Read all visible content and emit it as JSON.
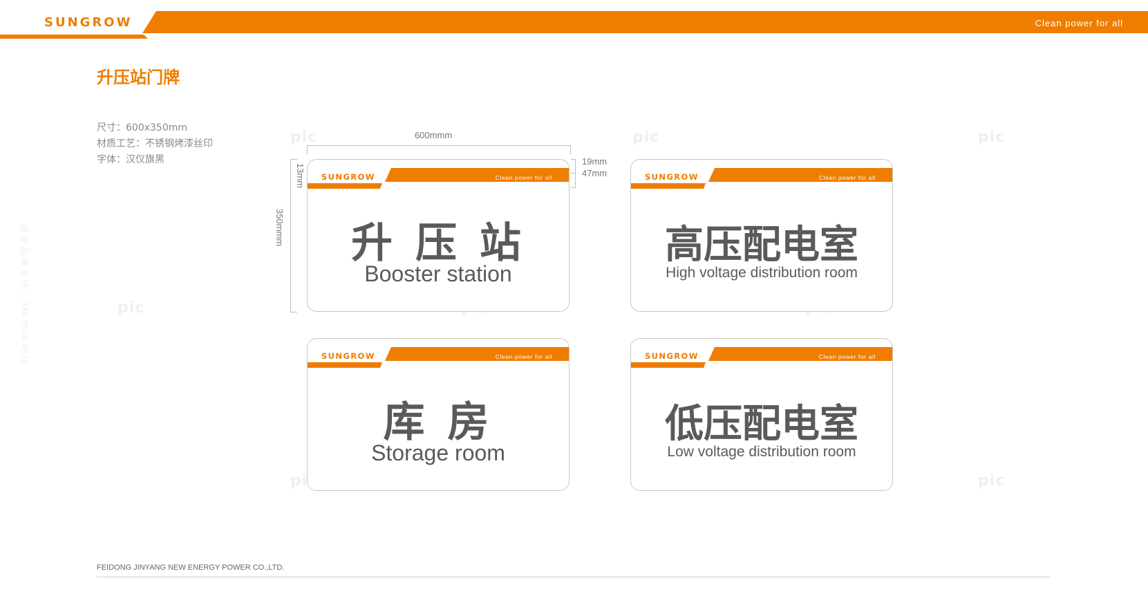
{
  "colors": {
    "accent": "#ef7d00",
    "text": "#5a5a5a",
    "border": "#c9c9c9"
  },
  "header": {
    "logo": "SUNGROW",
    "slogan": "Clean  power  for  all"
  },
  "page_title": "升压站门牌",
  "specs": [
    "尺寸：600x350mm",
    "材质工艺：不锈钢烤漆丝印",
    "字体：汉仪旗黑"
  ],
  "dimensions": {
    "width": "600mmm",
    "height": "350mmm",
    "side": "13mm",
    "top_band": "19mm",
    "band_height": "47mm"
  },
  "signs": [
    {
      "logo": "SUNGROW",
      "slogan": "Clean  power  for  all",
      "cn": "升 压 站",
      "en": "Booster station"
    },
    {
      "logo": "SUNGROW",
      "slogan": "Clean  power  for  all",
      "cn": "高压配电室",
      "en": "High voltage distribution room"
    },
    {
      "logo": "SUNGROW",
      "slogan": "Clean  power  for  all",
      "cn": "库 房",
      "en": "Storage room"
    },
    {
      "logo": "SUNGROW",
      "slogan": "Clean  power  for  all",
      "cn": "低压配电室",
      "en": "Low voltage distribution room"
    }
  ],
  "watermark": {
    "text": "pic",
    "side_text": "德 嘉 品 牌 设 计 ｜ 180 0500 4526"
  },
  "footer": {
    "company": "FEIDONG JINYANG NEW ENERGY POWER CO.,LTD."
  }
}
